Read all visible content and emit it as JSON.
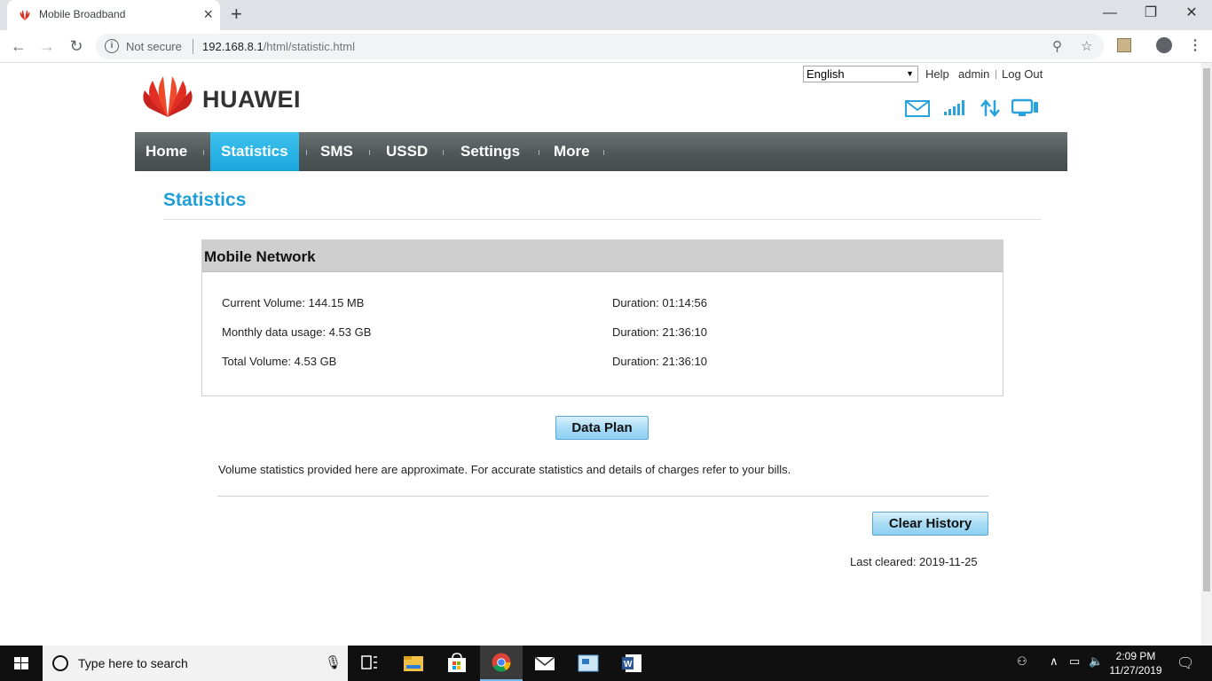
{
  "browser": {
    "tab_title": "Mobile Broadband",
    "tab_close": "×",
    "new_tab": "+",
    "security_label": "Not secure",
    "url_host": "192.168.8.1",
    "url_path": "/html/statistic.html",
    "icons": [
      "back-icon",
      "forward-icon",
      "reload-icon",
      "info-icon",
      "zoom-icon",
      "star-icon",
      "extension-icon",
      "account-icon",
      "menu-icon"
    ]
  },
  "header": {
    "language": "English",
    "links": {
      "help": "Help",
      "admin": "admin",
      "logout": "Log Out"
    },
    "brand": "HUAWEI"
  },
  "menu": {
    "items": [
      {
        "label": "Home",
        "active": false
      },
      {
        "label": "Statistics",
        "active": true
      },
      {
        "label": "SMS",
        "active": false
      },
      {
        "label": "USSD",
        "active": false
      },
      {
        "label": "Settings",
        "active": false
      },
      {
        "label": "More",
        "active": false
      }
    ]
  },
  "main": {
    "title": "Statistics",
    "panel_title": "Mobile Network",
    "rows": [
      {
        "volume": "Current Volume: 144.15 MB",
        "duration": "Duration: 01:14:56"
      },
      {
        "volume": "Monthly data usage: 4.53 GB",
        "duration": "Duration: 21:36:10"
      },
      {
        "volume": "Total Volume: 4.53 GB",
        "duration": "Duration: 21:36:10"
      }
    ],
    "data_plan_button": "Data Plan",
    "note": "Volume statistics provided here are approximate. For accurate statistics and details of charges refer to your bills.",
    "clear_history_button": "Clear History",
    "last_cleared": "Last cleared: 2019-11-25"
  },
  "taskbar": {
    "search_placeholder": "Type here to search",
    "time": "2:09 PM",
    "date": "11/27/2019"
  },
  "colors": {
    "accent": "#1f9ed8",
    "menu_bg": "#4d5557",
    "menu_active": "#2bb3e6"
  }
}
